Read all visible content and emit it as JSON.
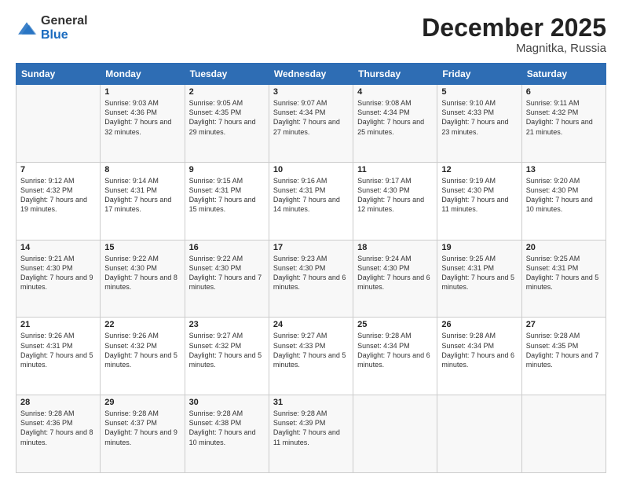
{
  "header": {
    "logo_general": "General",
    "logo_blue": "Blue",
    "month_title": "December 2025",
    "location": "Magnitka, Russia"
  },
  "days_of_week": [
    "Sunday",
    "Monday",
    "Tuesday",
    "Wednesday",
    "Thursday",
    "Friday",
    "Saturday"
  ],
  "weeks": [
    [
      {
        "day": "",
        "sunrise": "",
        "sunset": "",
        "daylight": ""
      },
      {
        "day": "1",
        "sunrise": "Sunrise: 9:03 AM",
        "sunset": "Sunset: 4:36 PM",
        "daylight": "Daylight: 7 hours and 32 minutes."
      },
      {
        "day": "2",
        "sunrise": "Sunrise: 9:05 AM",
        "sunset": "Sunset: 4:35 PM",
        "daylight": "Daylight: 7 hours and 29 minutes."
      },
      {
        "day": "3",
        "sunrise": "Sunrise: 9:07 AM",
        "sunset": "Sunset: 4:34 PM",
        "daylight": "Daylight: 7 hours and 27 minutes."
      },
      {
        "day": "4",
        "sunrise": "Sunrise: 9:08 AM",
        "sunset": "Sunset: 4:34 PM",
        "daylight": "Daylight: 7 hours and 25 minutes."
      },
      {
        "day": "5",
        "sunrise": "Sunrise: 9:10 AM",
        "sunset": "Sunset: 4:33 PM",
        "daylight": "Daylight: 7 hours and 23 minutes."
      },
      {
        "day": "6",
        "sunrise": "Sunrise: 9:11 AM",
        "sunset": "Sunset: 4:32 PM",
        "daylight": "Daylight: 7 hours and 21 minutes."
      }
    ],
    [
      {
        "day": "7",
        "sunrise": "Sunrise: 9:12 AM",
        "sunset": "Sunset: 4:32 PM",
        "daylight": "Daylight: 7 hours and 19 minutes."
      },
      {
        "day": "8",
        "sunrise": "Sunrise: 9:14 AM",
        "sunset": "Sunset: 4:31 PM",
        "daylight": "Daylight: 7 hours and 17 minutes."
      },
      {
        "day": "9",
        "sunrise": "Sunrise: 9:15 AM",
        "sunset": "Sunset: 4:31 PM",
        "daylight": "Daylight: 7 hours and 15 minutes."
      },
      {
        "day": "10",
        "sunrise": "Sunrise: 9:16 AM",
        "sunset": "Sunset: 4:31 PM",
        "daylight": "Daylight: 7 hours and 14 minutes."
      },
      {
        "day": "11",
        "sunrise": "Sunrise: 9:17 AM",
        "sunset": "Sunset: 4:30 PM",
        "daylight": "Daylight: 7 hours and 12 minutes."
      },
      {
        "day": "12",
        "sunrise": "Sunrise: 9:19 AM",
        "sunset": "Sunset: 4:30 PM",
        "daylight": "Daylight: 7 hours and 11 minutes."
      },
      {
        "day": "13",
        "sunrise": "Sunrise: 9:20 AM",
        "sunset": "Sunset: 4:30 PM",
        "daylight": "Daylight: 7 hours and 10 minutes."
      }
    ],
    [
      {
        "day": "14",
        "sunrise": "Sunrise: 9:21 AM",
        "sunset": "Sunset: 4:30 PM",
        "daylight": "Daylight: 7 hours and 9 minutes."
      },
      {
        "day": "15",
        "sunrise": "Sunrise: 9:22 AM",
        "sunset": "Sunset: 4:30 PM",
        "daylight": "Daylight: 7 hours and 8 minutes."
      },
      {
        "day": "16",
        "sunrise": "Sunrise: 9:22 AM",
        "sunset": "Sunset: 4:30 PM",
        "daylight": "Daylight: 7 hours and 7 minutes."
      },
      {
        "day": "17",
        "sunrise": "Sunrise: 9:23 AM",
        "sunset": "Sunset: 4:30 PM",
        "daylight": "Daylight: 7 hours and 6 minutes."
      },
      {
        "day": "18",
        "sunrise": "Sunrise: 9:24 AM",
        "sunset": "Sunset: 4:30 PM",
        "daylight": "Daylight: 7 hours and 6 minutes."
      },
      {
        "day": "19",
        "sunrise": "Sunrise: 9:25 AM",
        "sunset": "Sunset: 4:31 PM",
        "daylight": "Daylight: 7 hours and 5 minutes."
      },
      {
        "day": "20",
        "sunrise": "Sunrise: 9:25 AM",
        "sunset": "Sunset: 4:31 PM",
        "daylight": "Daylight: 7 hours and 5 minutes."
      }
    ],
    [
      {
        "day": "21",
        "sunrise": "Sunrise: 9:26 AM",
        "sunset": "Sunset: 4:31 PM",
        "daylight": "Daylight: 7 hours and 5 minutes."
      },
      {
        "day": "22",
        "sunrise": "Sunrise: 9:26 AM",
        "sunset": "Sunset: 4:32 PM",
        "daylight": "Daylight: 7 hours and 5 minutes."
      },
      {
        "day": "23",
        "sunrise": "Sunrise: 9:27 AM",
        "sunset": "Sunset: 4:32 PM",
        "daylight": "Daylight: 7 hours and 5 minutes."
      },
      {
        "day": "24",
        "sunrise": "Sunrise: 9:27 AM",
        "sunset": "Sunset: 4:33 PM",
        "daylight": "Daylight: 7 hours and 5 minutes."
      },
      {
        "day": "25",
        "sunrise": "Sunrise: 9:28 AM",
        "sunset": "Sunset: 4:34 PM",
        "daylight": "Daylight: 7 hours and 6 minutes."
      },
      {
        "day": "26",
        "sunrise": "Sunrise: 9:28 AM",
        "sunset": "Sunset: 4:34 PM",
        "daylight": "Daylight: 7 hours and 6 minutes."
      },
      {
        "day": "27",
        "sunrise": "Sunrise: 9:28 AM",
        "sunset": "Sunset: 4:35 PM",
        "daylight": "Daylight: 7 hours and 7 minutes."
      }
    ],
    [
      {
        "day": "28",
        "sunrise": "Sunrise: 9:28 AM",
        "sunset": "Sunset: 4:36 PM",
        "daylight": "Daylight: 7 hours and 8 minutes."
      },
      {
        "day": "29",
        "sunrise": "Sunrise: 9:28 AM",
        "sunset": "Sunset: 4:37 PM",
        "daylight": "Daylight: 7 hours and 9 minutes."
      },
      {
        "day": "30",
        "sunrise": "Sunrise: 9:28 AM",
        "sunset": "Sunset: 4:38 PM",
        "daylight": "Daylight: 7 hours and 10 minutes."
      },
      {
        "day": "31",
        "sunrise": "Sunrise: 9:28 AM",
        "sunset": "Sunset: 4:39 PM",
        "daylight": "Daylight: 7 hours and 11 minutes."
      },
      {
        "day": "",
        "sunrise": "",
        "sunset": "",
        "daylight": ""
      },
      {
        "day": "",
        "sunrise": "",
        "sunset": "",
        "daylight": ""
      },
      {
        "day": "",
        "sunrise": "",
        "sunset": "",
        "daylight": ""
      }
    ]
  ]
}
